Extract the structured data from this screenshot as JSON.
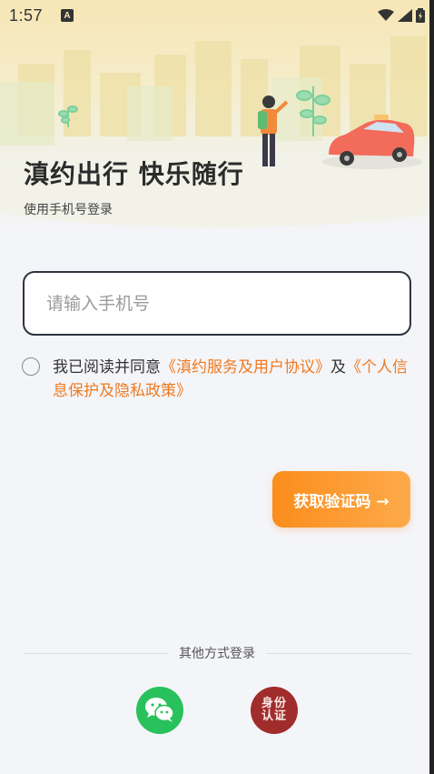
{
  "status_bar": {
    "time": "1:57",
    "a_badge": "A",
    "icons": [
      "wifi-icon",
      "signal-icon",
      "battery-icon"
    ]
  },
  "header": {
    "title": "滇约出行 快乐随行",
    "subtitle": "使用手机号登录"
  },
  "form": {
    "phone_placeholder": "请输入手机号",
    "phone_value": ""
  },
  "agreement": {
    "checked": false,
    "prefix": "我已阅读并同意",
    "service_link": "《滇约服务及用户协议》",
    "and": "及",
    "privacy_link": "《个人信息保护及隐私政策》"
  },
  "actions": {
    "get_code_label": "获取验证码 →"
  },
  "other_login": {
    "label": "其他方式登录",
    "id_line1": "身份",
    "id_line2": "认证"
  },
  "colors": {
    "accent": "#f07a1f",
    "button_start": "#fb8d1c",
    "button_end": "#fdaa4a",
    "wechat": "#29c15c",
    "id_auth": "#a02c2c",
    "taxi": "#f26b5b"
  }
}
